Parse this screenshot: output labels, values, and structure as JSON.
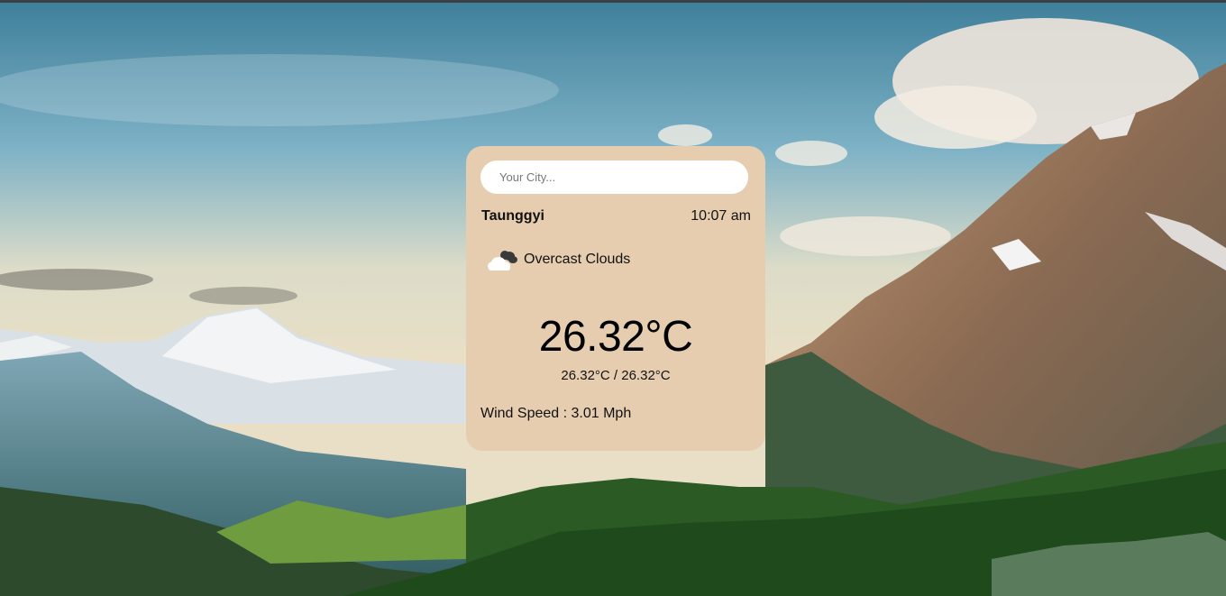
{
  "search": {
    "placeholder": "Your City..."
  },
  "weather": {
    "city": "Taunggyi",
    "time": "10:07 am",
    "condition": "Overcast Clouds",
    "condition_icon": "cloud-icon",
    "temperature": "26.32°C",
    "temp_range": "26.32°C / 26.32°C",
    "wind": "Wind Speed : 3.01 Mph"
  },
  "colors": {
    "card_background": "#e6cdb0",
    "search_background": "#ffffff"
  }
}
